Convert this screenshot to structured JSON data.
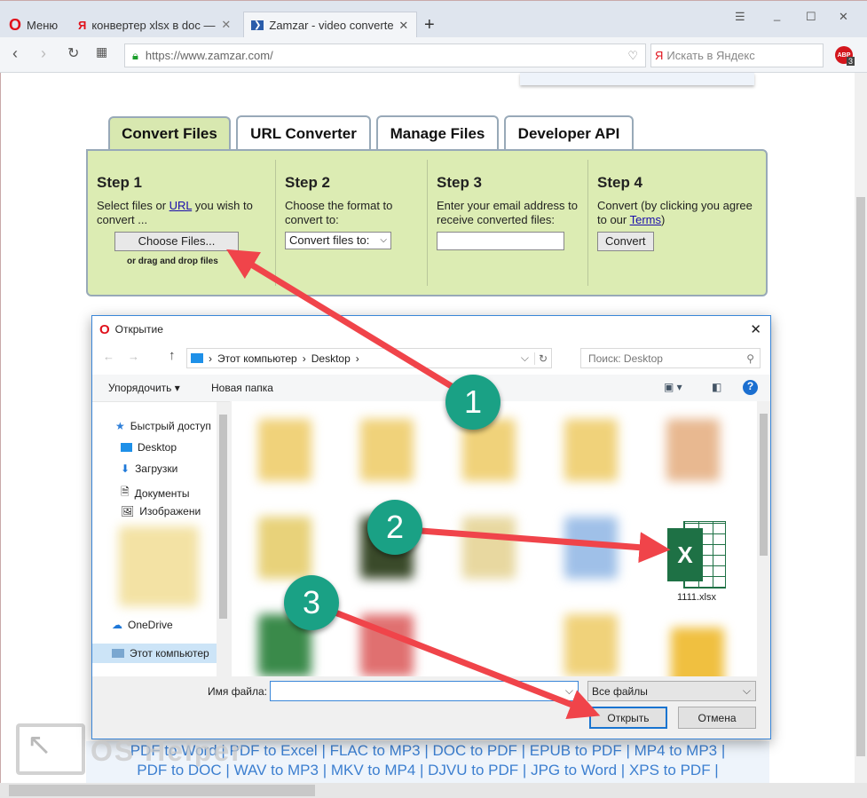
{
  "browser": {
    "menu_label": "Меню",
    "tabs": [
      {
        "title": "конвертер xlsx в doc — Я"
      },
      {
        "title": "Zamzar - video converter,"
      }
    ],
    "url": "https://www.zamzar.com/",
    "search_placeholder": "Искать в Яндекс",
    "abp_badge": "ABP",
    "abp_count": "3"
  },
  "zamzar": {
    "tabs": [
      "Convert Files",
      "URL Converter",
      "Manage Files",
      "Developer API"
    ],
    "step1": {
      "title": "Step 1",
      "text_a": "Select files or ",
      "link": "URL",
      "text_b": " you wish to convert ...",
      "button": "Choose Files...",
      "hint": "or drag and drop files"
    },
    "step2": {
      "title": "Step 2",
      "text": "Choose the format to convert to:",
      "select": "Convert files to:"
    },
    "step3": {
      "title": "Step 3",
      "text": "Enter your email address to receive converted files:",
      "email_value": ""
    },
    "step4": {
      "title": "Step 4",
      "text_a": "Convert (by clicking you agree to our ",
      "link": "Terms",
      "text_b": ")",
      "button": "Convert"
    },
    "links": [
      "PDF to Word",
      "PDF to Excel",
      "FLAC to MP3",
      "DOC to PDF",
      "EPUB to PDF",
      "MP4 to MP3",
      "PDF to DOC",
      "WAV to MP3",
      "MKV to MP4",
      "DJVU to PDF",
      "JPG to Word",
      "XPS to PDF"
    ]
  },
  "dialog": {
    "title": "Открытие",
    "breadcrumb": [
      "Этот компьютер",
      "Desktop"
    ],
    "search_placeholder": "Поиск: Desktop",
    "organize": "Упорядочить",
    "new_folder": "Новая папка",
    "sidebar": [
      {
        "label": "Быстрый доступ"
      },
      {
        "label": "Desktop"
      },
      {
        "label": "Загрузки"
      },
      {
        "label": "Документы"
      },
      {
        "label": "Изображени"
      },
      {
        "label": "OneDrive"
      },
      {
        "label": "Этот компьютер"
      }
    ],
    "file": {
      "name": "1111.xlsx"
    },
    "filename_label": "Имя файла:",
    "filename_value": "",
    "filetype": "Все файлы",
    "open": "Открыть",
    "cancel": "Отмена"
  },
  "annotations": [
    "1",
    "2",
    "3"
  ],
  "watermark": "OS Helper"
}
